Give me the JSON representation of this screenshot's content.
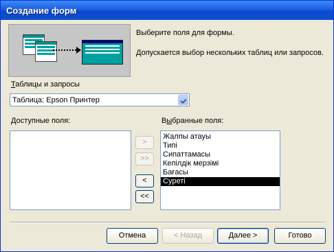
{
  "window": {
    "title": "Создание форм"
  },
  "intro": {
    "line1": "Выберите поля для формы.",
    "line2": "Допускается выбор нескольких таблиц или запросов."
  },
  "source": {
    "label_underlined": "Т",
    "label_rest": "аблицы и запросы",
    "selected": "Таблица: Epson Принтер"
  },
  "available": {
    "label_underlined": "Д",
    "label_rest": "оступные поля:",
    "items": []
  },
  "selected_fields": {
    "label_prefix": "В",
    "label_underlined": "ы",
    "label_rest": "бранные поля:",
    "items": [
      "Жалпы атауы",
      "Типі",
      "Сипаттамасы",
      "Кепілдік мерзімі",
      "Бағасы",
      "Суреті"
    ],
    "selected_index": 5
  },
  "move_buttons": {
    "add_one": ">",
    "add_all": ">>",
    "remove_one": "<",
    "remove_all": "<<"
  },
  "buttons": {
    "cancel": "Отмена",
    "back": "< Назад",
    "next_underlined": "Д",
    "next_rest": "алее >",
    "finish": "Готово"
  }
}
